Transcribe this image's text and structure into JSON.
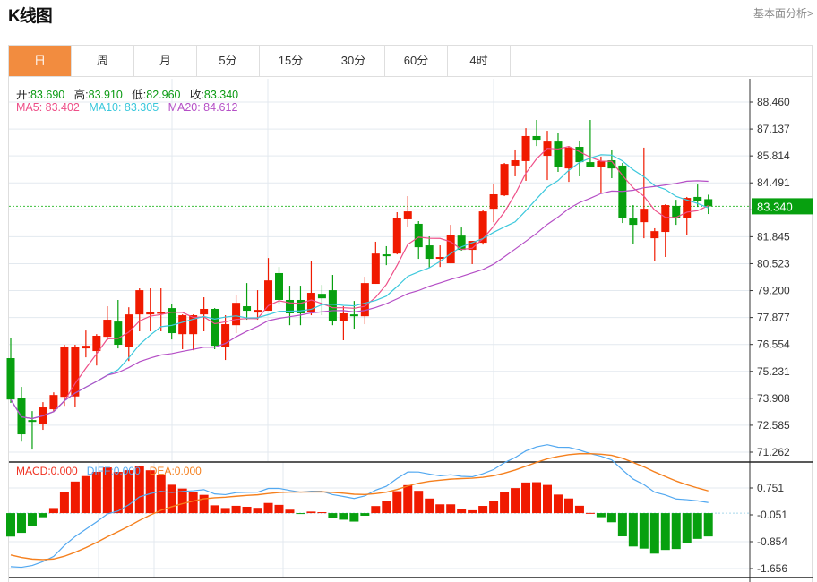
{
  "header": {
    "title": "K线图",
    "fundamental_link": "基本面分析>"
  },
  "tabs": [
    {
      "label": "日",
      "active": true
    },
    {
      "label": "周"
    },
    {
      "label": "月"
    },
    {
      "label": "5分"
    },
    {
      "label": "15分"
    },
    {
      "label": "30分"
    },
    {
      "label": "60分"
    },
    {
      "label": "4时"
    }
  ],
  "info": {
    "open_label": "开:",
    "open": "83.690",
    "high_label": "高:",
    "high": "83.910",
    "low_label": "低:",
    "low": "82.960",
    "close_label": "收:",
    "close": "83.340"
  },
  "ma": {
    "ma5": "MA5: 83.402",
    "ma10": "MA10: 83.305",
    "ma20": "MA20: 84.612"
  },
  "macd_legend": {
    "macd": "MACD:0.000",
    "diff": "DIFF:0.000",
    "dea": "DEA:0.000"
  },
  "colors": {
    "up": "#f01a00",
    "down": "#07a00f",
    "ma5": "#ee4f88",
    "ma10": "#3cc8dc",
    "ma20": "#b54fc6",
    "diff": "#52a8f0",
    "dea": "#f5801e",
    "accent": "#f28c3f"
  },
  "chart_data": [
    {
      "type": "candlestick",
      "title": "K线图",
      "ylim": [
        71.262,
        88.46
      ],
      "y_ticks": [
        "88.460",
        "87.137",
        "85.814",
        "84.491",
        "",
        "81.845",
        "80.523",
        "79.200",
        "77.877",
        "76.554",
        "75.231",
        "73.908",
        "72.585",
        "71.262"
      ],
      "current_price": "83.340",
      "grid": true,
      "candles_ohlc": [
        [
          75.88,
          76.89,
          73.68,
          73.85
        ],
        [
          73.94,
          74.47,
          71.78,
          72.14
        ],
        [
          72.84,
          73.28,
          71.39,
          72.75
        ],
        [
          72.66,
          73.72,
          72.36,
          73.46
        ],
        [
          73.37,
          74.2,
          73.24,
          74.07
        ],
        [
          73.98,
          76.54,
          73.54,
          76.45
        ],
        [
          74.0,
          76.54,
          73.5,
          76.45
        ],
        [
          76.36,
          77.24,
          75.92,
          76.49
        ],
        [
          76.23,
          77.06,
          75.52,
          76.98
        ],
        [
          76.93,
          78.43,
          76.76,
          77.77
        ],
        [
          77.68,
          78.74,
          76.36,
          76.54
        ],
        [
          76.45,
          78.38,
          75.74,
          78.03
        ],
        [
          78.03,
          79.31,
          77.2,
          79.22
        ],
        [
          78.03,
          79.31,
          77.2,
          78.16
        ],
        [
          78.06,
          79.31,
          77.2,
          78.16
        ],
        [
          78.34,
          78.56,
          76.8,
          77.11
        ],
        [
          77.06,
          78.03,
          76.32,
          77.99
        ],
        [
          77.06,
          78.03,
          76.27,
          77.99
        ],
        [
          78.03,
          78.87,
          77.2,
          78.3
        ],
        [
          78.3,
          78.34,
          76.32,
          76.49
        ],
        [
          76.45,
          77.99,
          75.79,
          77.55
        ],
        [
          77.5,
          78.96,
          77.11,
          78.6
        ],
        [
          78.43,
          79.57,
          77.77,
          78.21
        ],
        [
          78.12,
          79.22,
          77.77,
          78.25
        ],
        [
          78.21,
          80.8,
          78.21,
          79.7
        ],
        [
          80.06,
          80.36,
          78.56,
          78.74
        ],
        [
          78.74,
          79.44,
          77.5,
          78.08
        ],
        [
          78.74,
          79.44,
          77.5,
          78.08
        ],
        [
          78.16,
          80.63,
          77.99,
          79.09
        ],
        [
          79.04,
          79.48,
          77.99,
          78.82
        ],
        [
          79.22,
          79.97,
          77.5,
          77.72
        ],
        [
          77.72,
          78.43,
          76.76,
          78.08
        ],
        [
          78.03,
          78.69,
          77.33,
          77.94
        ],
        [
          77.94,
          79.88,
          77.55,
          79.57
        ],
        [
          79.53,
          81.6,
          79.53,
          81.02
        ],
        [
          80.98,
          81.38,
          80.45,
          80.89
        ],
        [
          81.02,
          83.05,
          80.98,
          82.78
        ],
        [
          82.7,
          83.84,
          82.34,
          83.09
        ],
        [
          82.48,
          82.61,
          80.76,
          81.33
        ],
        [
          81.42,
          81.86,
          80.32,
          80.76
        ],
        [
          80.76,
          81.42,
          80.36,
          80.85
        ],
        [
          80.54,
          82.43,
          80.54,
          81.95
        ],
        [
          81.9,
          82.3,
          81.16,
          81.2
        ],
        [
          81.2,
          81.64,
          80.5,
          81.64
        ],
        [
          81.55,
          83.14,
          81.46,
          83.09
        ],
        [
          83.22,
          84.46,
          82.56,
          83.93
        ],
        [
          83.88,
          85.47,
          83.84,
          85.42
        ],
        [
          85.34,
          86.13,
          84.81,
          85.6
        ],
        [
          85.56,
          87.18,
          84.59,
          86.79
        ],
        [
          86.79,
          87.58,
          86.3,
          86.61
        ],
        [
          85.82,
          87.05,
          84.63,
          86.52
        ],
        [
          86.52,
          86.92,
          85.03,
          85.25
        ],
        [
          85.2,
          86.3,
          84.54,
          86.22
        ],
        [
          86.26,
          86.57,
          84.81,
          85.51
        ],
        [
          85.51,
          87.58,
          85.25,
          85.25
        ],
        [
          85.29,
          85.78,
          84.02,
          85.56
        ],
        [
          85.6,
          86.13,
          84.72,
          85.2
        ],
        [
          85.34,
          85.47,
          82.52,
          82.78
        ],
        [
          82.74,
          83.4,
          81.51,
          82.43
        ],
        [
          82.56,
          86.22,
          81.77,
          83.22
        ],
        [
          81.77,
          82.26,
          80.67,
          82.12
        ],
        [
          82.08,
          83.44,
          80.85,
          83.4
        ],
        [
          83.36,
          83.66,
          82.43,
          82.78
        ],
        [
          82.78,
          83.8,
          81.95,
          83.75
        ],
        [
          83.8,
          84.41,
          83.31,
          83.58
        ],
        [
          83.69,
          83.91,
          82.96,
          83.34
        ]
      ],
      "series": [
        {
          "name": "MA5"
        },
        {
          "name": "MA10"
        },
        {
          "name": "MA20"
        }
      ]
    },
    {
      "type": "bar+line",
      "title": "MACD",
      "ylim": [
        -1.656,
        0.751
      ],
      "y_ticks": [
        "0.751",
        "-0.051",
        "-0.854",
        "-1.656"
      ],
      "series": [
        {
          "name": "MACD"
        },
        {
          "name": "DIFF"
        },
        {
          "name": "DEA"
        }
      ]
    }
  ]
}
